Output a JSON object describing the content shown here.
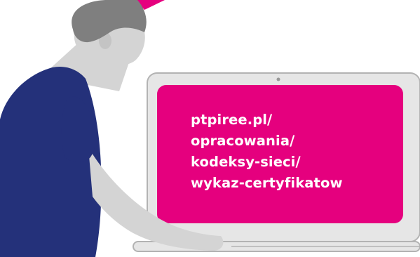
{
  "colors": {
    "screen": "#e5007e",
    "laptop_body": "#e6e6e6",
    "laptop_outline": "#b3b3b3",
    "shirt": "#24317a",
    "hair": "#7f7f7f",
    "skin": "#d4d4d4",
    "text": "#ffffff"
  },
  "screen": {
    "lines": [
      "ptpiree.pl/",
      "opracowania/",
      "kodeksy-sieci/",
      "wykaz-certyfikatow"
    ]
  }
}
